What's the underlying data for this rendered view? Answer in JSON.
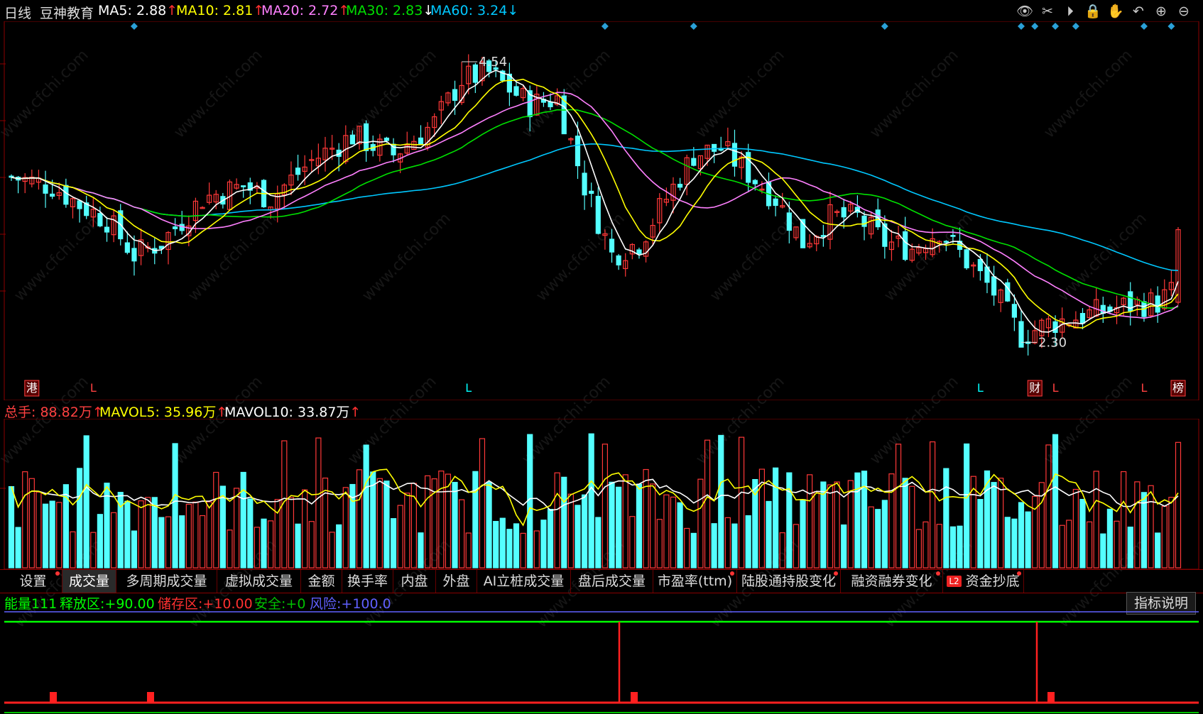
{
  "header": {
    "period": "日线",
    "stock_name": "豆神教育",
    "ma5": {
      "label": "MA5:",
      "value": "2.88",
      "arrow": "↑",
      "color": "#ffffff"
    },
    "ma10": {
      "label": "MA10:",
      "value": "2.81",
      "arrow": "↑",
      "color": "#ffff00"
    },
    "ma20": {
      "label": "MA20:",
      "value": "2.72",
      "arrow": "↑",
      "color": "#ff80ff"
    },
    "ma30": {
      "label": "MA30:",
      "value": "2.83",
      "arrow": "↓",
      "color": "#00e000"
    },
    "ma60": {
      "label": "MA60:",
      "value": "3.24",
      "arrow": "↓",
      "color": "#00c8ff"
    }
  },
  "toolbar_icons": [
    "eye-icon",
    "scissors-icon",
    "play-icon",
    "lock-icon",
    "hand-icon",
    "undo-icon",
    "zoom-in-icon",
    "zoom-out-icon"
  ],
  "chart_data": {
    "type": "candlestick",
    "high_label": "4.54",
    "low_label": "2.30",
    "price_range": [
      2.2,
      4.75
    ],
    "bottom_markers": [
      {
        "text": "港",
        "boxed": true,
        "color": "#ff4040",
        "idx": 3
      },
      {
        "text": "L",
        "color": "#ff4040",
        "idx": 12
      },
      {
        "text": "L",
        "color": "#00ffff",
        "idx": 67
      },
      {
        "text": "L",
        "color": "#00ffff",
        "idx": 142
      },
      {
        "text": "财",
        "boxed": true,
        "color": "#ff4040",
        "idx": 150
      },
      {
        "text": "L",
        "color": "#ff4040",
        "idx": 153
      },
      {
        "text": "L",
        "color": "#ff4040",
        "idx": 166
      },
      {
        "text": "榜",
        "boxed": true,
        "color": "#ff4040",
        "idx": 171
      }
    ],
    "top_diamond_idx": [
      18,
      87,
      100,
      128,
      148,
      150,
      153,
      156,
      166,
      170
    ]
  },
  "volume_header": {
    "total": {
      "label": "总手:",
      "value": "88.82万",
      "arrow": "↑",
      "color": "#ff4040"
    },
    "mavol5": {
      "label": "MAVOL5:",
      "value": "35.96万",
      "arrow": "↑",
      "color": "#ffff00"
    },
    "mavol10": {
      "label": "MAVOL10:",
      "value": "33.87万",
      "arrow": "↑",
      "color": "#ffffff"
    }
  },
  "tabs": [
    {
      "label": "设置",
      "dot": true
    },
    {
      "label": "成交量",
      "active": true
    },
    {
      "label": "多周期成交量"
    },
    {
      "label": "虚拟成交量"
    },
    {
      "label": "金额"
    },
    {
      "label": "换手率"
    },
    {
      "label": "内盘"
    },
    {
      "label": "外盘"
    },
    {
      "label": "AI立桩成交量"
    },
    {
      "label": "盘后成交量"
    },
    {
      "label": "市盈率(ttm)",
      "dot": true
    },
    {
      "label": "陆股通持股变化",
      "dot": true
    },
    {
      "label": "融资融券变化",
      "dot": true
    },
    {
      "label": "资金抄底",
      "dot": true,
      "badge": "L2"
    }
  ],
  "indicator_header": {
    "name": "能量111",
    "release": {
      "label": "释放区:",
      "value": "+90.00",
      "color": "#00ff00"
    },
    "storage": {
      "label": "储存区:",
      "value": "+10.00",
      "color": "#ff3030"
    },
    "safe": {
      "label": "安全:",
      "value": "+0",
      "color": "#00c000"
    },
    "risk": {
      "label": "风险:",
      "value": "+100.0",
      "color": "#6060ff"
    }
  },
  "explain_button": "指标说明",
  "watermark": "www.cfchi.com"
}
